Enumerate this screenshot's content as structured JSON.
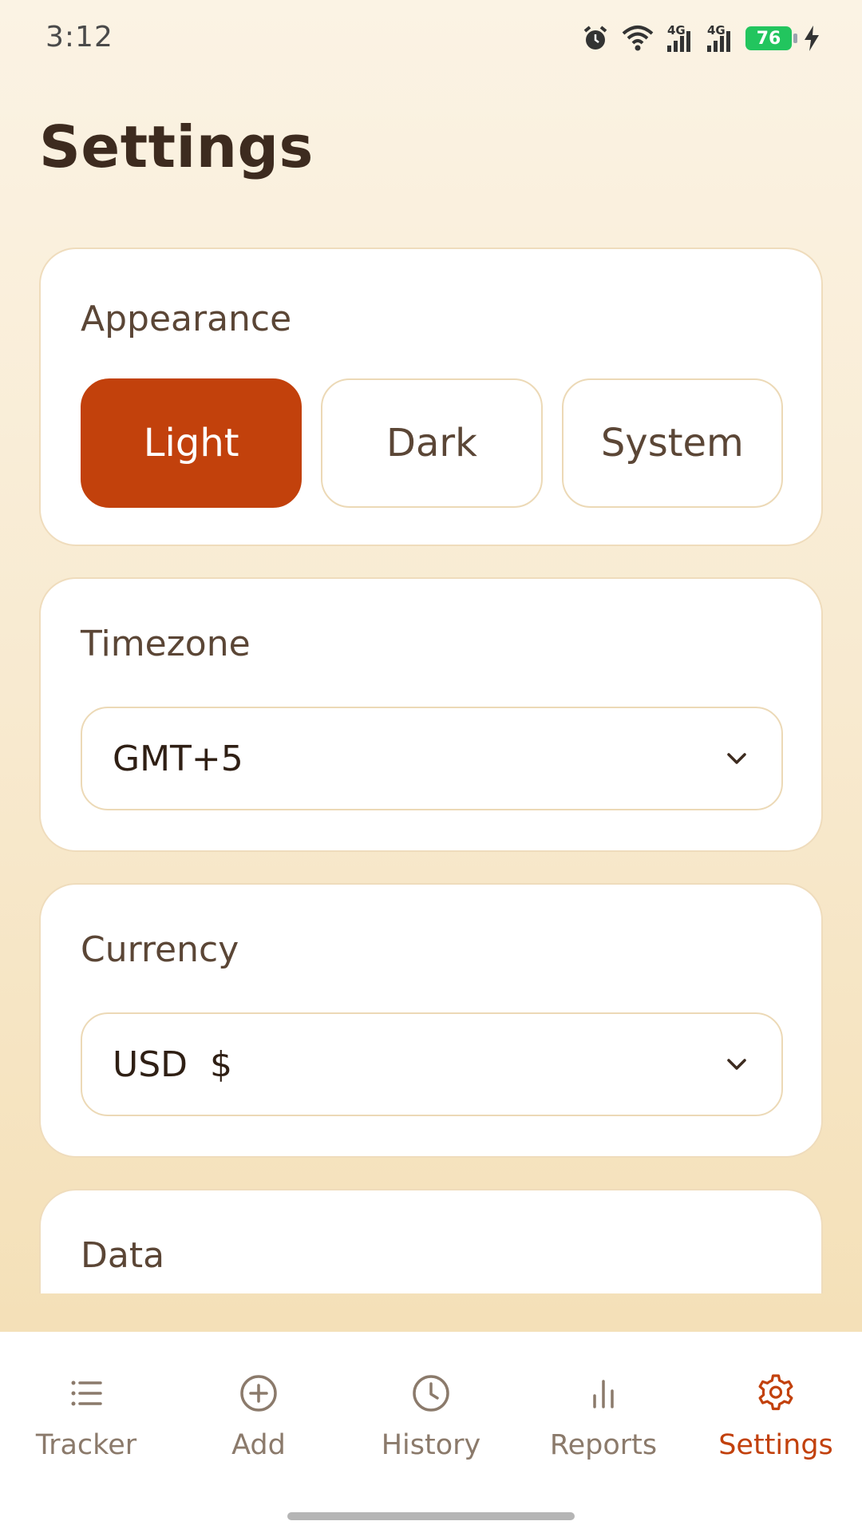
{
  "status_bar": {
    "time": "3:12",
    "network_label_1": "4G",
    "network_label_2": "4G",
    "battery": "76",
    "icons": [
      "alarm-icon",
      "wifi-icon",
      "signal-icon",
      "signal-icon",
      "battery-icon",
      "charging-icon"
    ]
  },
  "page": {
    "title": "Settings"
  },
  "appearance": {
    "title": "Appearance",
    "options": [
      "Light",
      "Dark",
      "System"
    ],
    "selected": "Light"
  },
  "timezone": {
    "title": "Timezone",
    "value": "GMT+5"
  },
  "currency": {
    "title": "Currency",
    "value": "USD  $"
  },
  "data_section": {
    "title": "Data"
  },
  "nav": {
    "items": [
      {
        "label": "Tracker",
        "icon": "list-icon"
      },
      {
        "label": "Add",
        "icon": "plus-circle-icon"
      },
      {
        "label": "History",
        "icon": "clock-icon"
      },
      {
        "label": "Reports",
        "icon": "bar-chart-icon"
      },
      {
        "label": "Settings",
        "icon": "gear-icon"
      }
    ],
    "active": "Settings"
  },
  "colors": {
    "accent": "#c2410c",
    "background_top": "#fbf3e4",
    "background_bottom": "#f3ddb0",
    "card_border": "#efdcbc",
    "battery": "#22c55e"
  }
}
